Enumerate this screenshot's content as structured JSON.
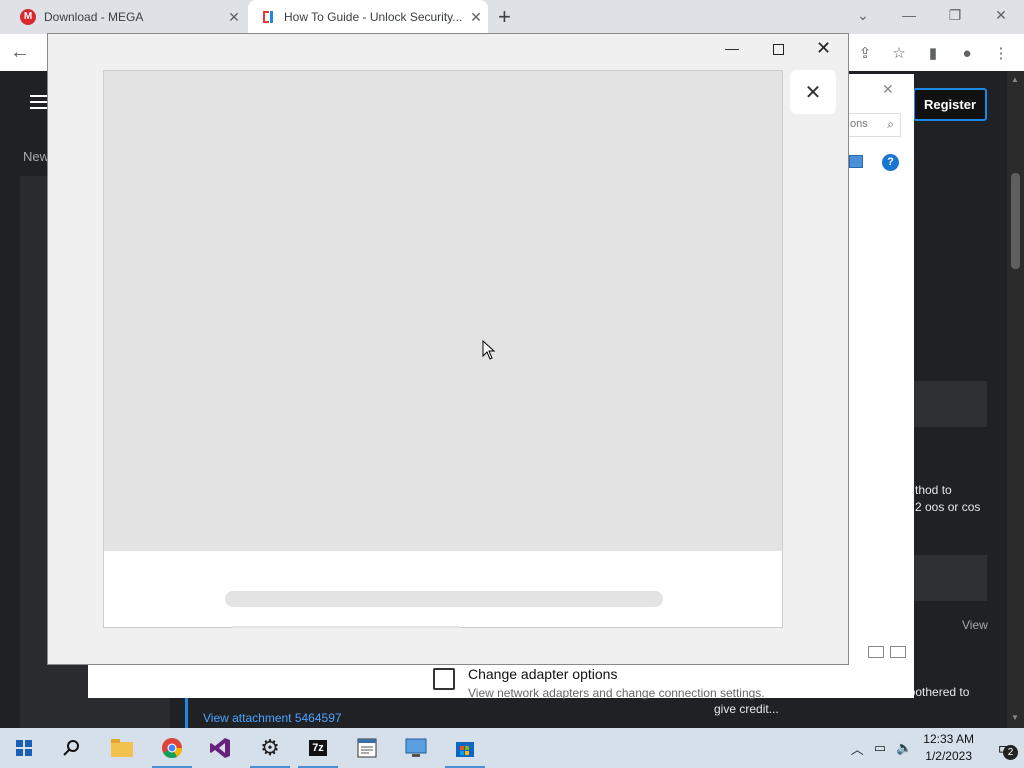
{
  "browser": {
    "tabs": [
      {
        "title": "Download - MEGA",
        "active": false
      },
      {
        "title": "How To Guide - Unlock Security...",
        "active": true
      }
    ],
    "new_tab_label": "+"
  },
  "site": {
    "register_label": "Register",
    "new_label": "New",
    "snippet_lines": [
      "thod to",
      "2 oos or cos"
    ],
    "view_label": "View",
    "bothered_text": "be bothered to",
    "give_credit_text": "give credit...",
    "attachment_link": "View attachment 5464597"
  },
  "control_panel": {
    "search_placeholder": "ons",
    "help_label": "?",
    "adapter_title": "Change adapter options",
    "adapter_desc": "View network adapters and change connection settings."
  },
  "modal": {
    "minimize_label": "—",
    "close_label": "✕",
    "inner_close_label": "✕"
  },
  "taskbar": {
    "apps": [
      {
        "name": "start"
      },
      {
        "name": "search"
      },
      {
        "name": "file-explorer"
      },
      {
        "name": "chrome",
        "active": true
      },
      {
        "name": "visual-studio"
      },
      {
        "name": "settings",
        "active": true
      },
      {
        "name": "7zip",
        "active": true
      },
      {
        "name": "notepad"
      },
      {
        "name": "remote-desktop"
      },
      {
        "name": "store",
        "active": true
      }
    ],
    "time": "12:33 AM",
    "date": "1/2/2023",
    "notification_count": "2"
  }
}
